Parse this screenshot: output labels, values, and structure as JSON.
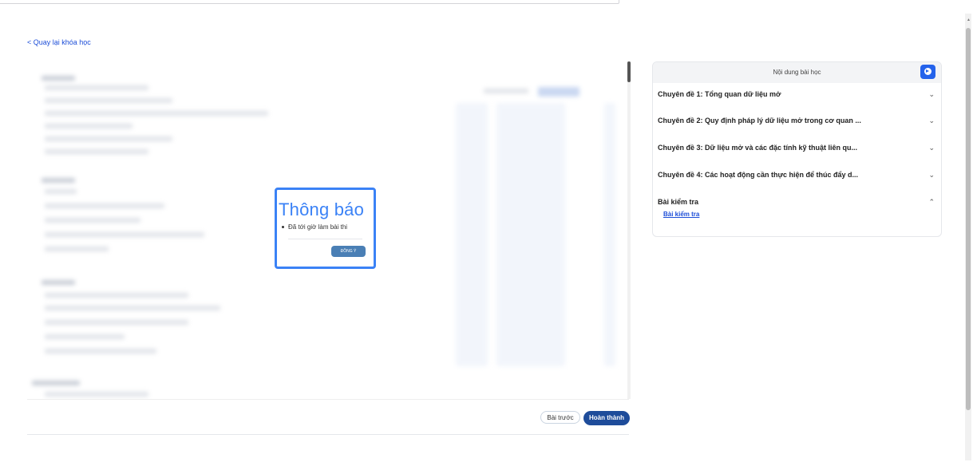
{
  "nav": {
    "back_label": "< Quay lại khóa học"
  },
  "modal": {
    "title": "Thông báo",
    "message": "Đã tới giờ làm bài thi",
    "confirm_label": "ĐỒNG Ý"
  },
  "footer": {
    "prev_label": "Bài trước",
    "done_label": "Hoàn thành"
  },
  "sidebar": {
    "title": "Nội dung bài học",
    "chapters": [
      {
        "label": "Chuyên đề 1: Tổng quan dữ liệu mở",
        "expanded": false
      },
      {
        "label": "Chuyên đề 2: Quy định pháp lý dữ liệu mở trong cơ quan ...",
        "expanded": false
      },
      {
        "label": "Chuyên đề 3: Dữ liệu mở và các đặc tính kỹ thuật liên qu...",
        "expanded": false
      },
      {
        "label": "Chuyên đề 4: Các hoạt động cần thực hiện để thúc đẩy d...",
        "expanded": false
      },
      {
        "label": "Bài kiểm tra",
        "expanded": true,
        "items": [
          "Bài kiểm tra"
        ]
      }
    ]
  },
  "colors": {
    "accent": "#3b82f6",
    "primary_button": "#1e4c9a",
    "modal_button": "#4a7fb5",
    "link": "#1d4ed8"
  }
}
